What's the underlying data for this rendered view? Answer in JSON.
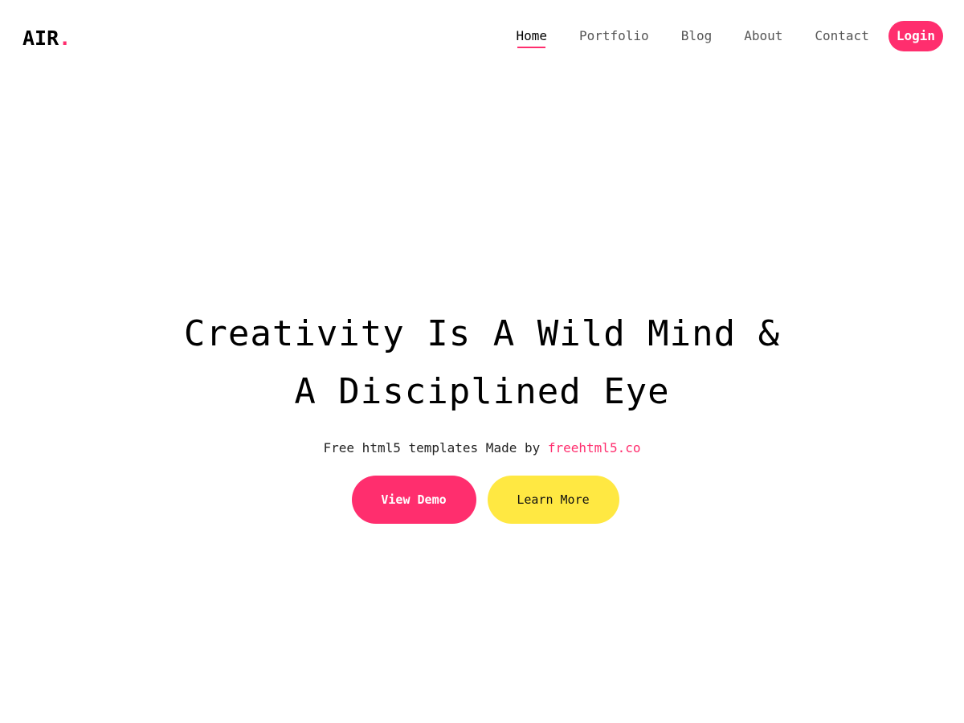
{
  "header": {
    "logo_text": "AIR",
    "logo_dot": ".",
    "nav": [
      {
        "label": "Home"
      },
      {
        "label": "Portfolio"
      },
      {
        "label": "Blog"
      },
      {
        "label": "About"
      },
      {
        "label": "Contact"
      }
    ],
    "login_label": "Login"
  },
  "hero": {
    "title_line1": "Creativity Is A Wild Mind &",
    "title_line2": "A Disciplined Eye",
    "subtitle_prefix": "Free html5 templates Made by ",
    "subtitle_link": "freehtml5.co",
    "primary_button": "View Demo",
    "secondary_button": "Learn More"
  },
  "colors": {
    "accent": "#ff2e6e",
    "secondary_button": "#ffe842",
    "background": "#ffffff"
  }
}
